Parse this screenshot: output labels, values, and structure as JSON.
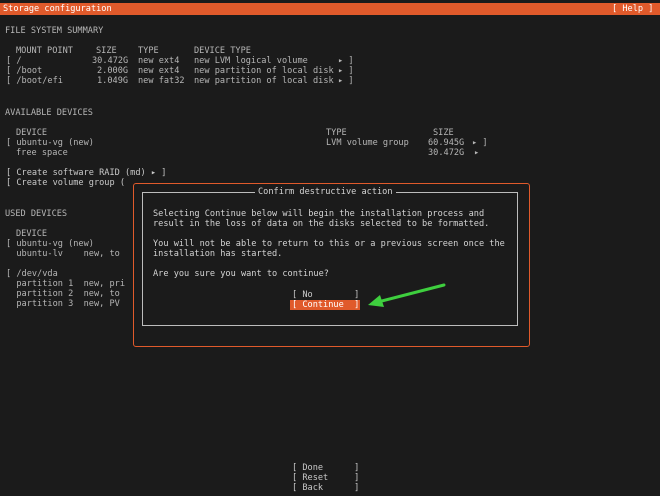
{
  "header": {
    "title": "Storage configuration",
    "help": "[ Help ]"
  },
  "fs_summary": {
    "heading": "FILE SYSTEM SUMMARY",
    "columns": [
      "MOUNT POINT",
      "SIZE",
      "TYPE",
      "DEVICE TYPE"
    ],
    "rows": [
      {
        "mount": "[ /",
        "size": "30.472G",
        "type": "new ext4",
        "device": "new LVM logical volume",
        "arrow": "▸ ]"
      },
      {
        "mount": "[ /boot",
        "size": "2.000G",
        "type": "new ext4",
        "device": "new partition of local disk",
        "arrow": "▸ ]"
      },
      {
        "mount": "[ /boot/efi",
        "size": "1.049G",
        "type": "new fat32",
        "device": "new partition of local disk",
        "arrow": "▸ ]"
      }
    ]
  },
  "available": {
    "heading": "AVAILABLE DEVICES",
    "col_device": "DEVICE",
    "col_type": "TYPE",
    "col_size": "SIZE",
    "row1_device": "[ ubuntu-vg (new)",
    "row1_type": "LVM volume group",
    "row1_size": "60.945G",
    "row1_arrow": "▸ ]",
    "row2_device": "free space",
    "row2_size": "30.472G",
    "row2_arrow": "▸",
    "action_raid": "[ Create software RAID (md) ▸ ]",
    "action_vg": "[ Create volume group ("
  },
  "used": {
    "heading": "USED DEVICES",
    "col_device": "DEVICE",
    "lines": [
      "[ ubuntu-vg (new)",
      "  ubuntu-lv    new, to",
      "",
      "[ /dev/vda",
      "  partition 1  new, pri",
      "  partition 2  new, to",
      "  partition 3  new, PV"
    ]
  },
  "dialog": {
    "title": "Confirm destructive action",
    "para1_line1": "Selecting Continue below will begin the installation process and",
    "para1_line2": "result in the loss of data on the disks selected to be formatted.",
    "para2_line1": "You will not be able to return to this or a previous screen once the",
    "para2_line2": "installation has started.",
    "question": "Are you sure you want to continue?",
    "no_button": "[ No        ]",
    "continue_button": "[ Continue  ]"
  },
  "bottom_buttons": {
    "done": "[ Done      ]",
    "reset": "[ Reset     ]",
    "back": "[ Back      ]"
  },
  "colors": {
    "accent": "#e05a2b",
    "arrow": "#3ecf3e",
    "background": "#1b1b1b"
  },
  "icons": {
    "annotation": "green-arrow-icon"
  }
}
